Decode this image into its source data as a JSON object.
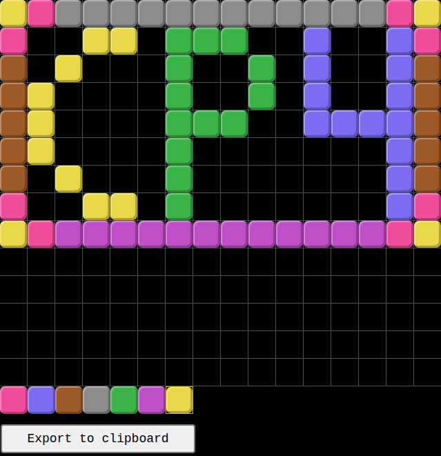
{
  "grid": [
    [
      6,
      0,
      3,
      3,
      3,
      3,
      3,
      3,
      3,
      3,
      3,
      3,
      3,
      3,
      0,
      6
    ],
    [
      0,
      -1,
      -1,
      6,
      6,
      -1,
      4,
      4,
      4,
      -1,
      -1,
      1,
      -1,
      -1,
      1,
      0
    ],
    [
      2,
      -1,
      6,
      -1,
      -1,
      -1,
      4,
      -1,
      -1,
      4,
      -1,
      1,
      -1,
      -1,
      1,
      2
    ],
    [
      2,
      6,
      -1,
      -1,
      -1,
      -1,
      4,
      -1,
      -1,
      4,
      -1,
      1,
      -1,
      -1,
      1,
      2
    ],
    [
      2,
      6,
      -1,
      -1,
      -1,
      -1,
      4,
      4,
      4,
      -1,
      -1,
      1,
      1,
      1,
      1,
      2
    ],
    [
      2,
      6,
      -1,
      -1,
      -1,
      -1,
      4,
      -1,
      -1,
      -1,
      -1,
      -1,
      -1,
      -1,
      1,
      2
    ],
    [
      2,
      -1,
      6,
      -1,
      -1,
      -1,
      4,
      -1,
      -1,
      -1,
      -1,
      -1,
      -1,
      -1,
      1,
      2
    ],
    [
      0,
      -1,
      -1,
      6,
      6,
      -1,
      4,
      -1,
      -1,
      -1,
      -1,
      -1,
      -1,
      -1,
      1,
      0
    ],
    [
      6,
      0,
      5,
      5,
      5,
      5,
      5,
      5,
      5,
      5,
      5,
      5,
      5,
      5,
      0,
      6
    ],
    [
      -1,
      -1,
      -1,
      -1,
      -1,
      -1,
      -1,
      -1,
      -1,
      -1,
      -1,
      -1,
      -1,
      -1,
      -1,
      -1
    ],
    [
      -1,
      -1,
      -1,
      -1,
      -1,
      -1,
      -1,
      -1,
      -1,
      -1,
      -1,
      -1,
      -1,
      -1,
      -1,
      -1
    ],
    [
      -1,
      -1,
      -1,
      -1,
      -1,
      -1,
      -1,
      -1,
      -1,
      -1,
      -1,
      -1,
      -1,
      -1,
      -1,
      -1
    ],
    [
      -1,
      -1,
      -1,
      -1,
      -1,
      -1,
      -1,
      -1,
      -1,
      -1,
      -1,
      -1,
      -1,
      -1,
      -1,
      -1
    ],
    [
      -1,
      -1,
      -1,
      -1,
      -1,
      -1,
      -1,
      -1,
      -1,
      -1,
      -1,
      -1,
      -1,
      -1,
      -1,
      -1
    ]
  ],
  "palette": [
    {
      "color": "#f04c9c",
      "selected": false
    },
    {
      "color": "#7b6cf0",
      "selected": false
    },
    {
      "color": "#9c5a28",
      "selected": false
    },
    {
      "color": "#8c8c8c",
      "selected": false
    },
    {
      "color": "#3cb44a",
      "selected": false
    },
    {
      "color": "#c050c8",
      "selected": false
    },
    {
      "color": "#e8d84a",
      "selected": true
    }
  ],
  "export_button": "Export to clipboard"
}
